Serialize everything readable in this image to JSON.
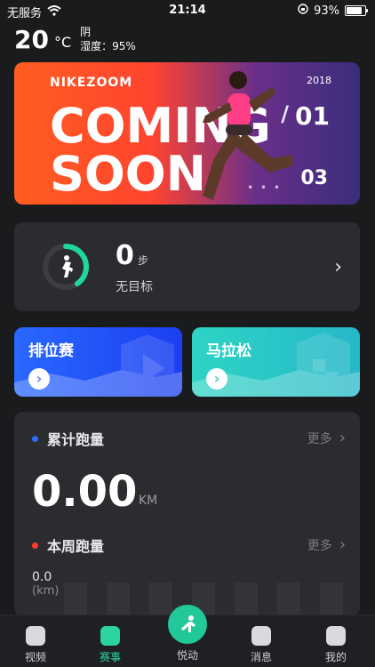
{
  "status": {
    "carrier": "无服务",
    "time": "21:14",
    "battery_percent": "93%",
    "battery_level": 0.93
  },
  "weather": {
    "temp": "20",
    "unit": "°C",
    "condition": "阴",
    "humidity": "湿度：95%"
  },
  "banner": {
    "brand": "NIKEZOOM",
    "line1": "COMING",
    "line2": "SOON",
    "year": "2018",
    "slash": "/",
    "index": "01",
    "total": "03",
    "dots": "• • •"
  },
  "steps": {
    "count": "0",
    "unit": "步",
    "goal": "无目标"
  },
  "cards": {
    "rank": "排位赛",
    "marathon": "马拉松"
  },
  "stats": {
    "cumulative_label": "累计跑量",
    "more1": "更多",
    "distance": "0.00",
    "distance_unit": "KM",
    "week_label": "本周跑量",
    "more2": "更多",
    "week_value": "0.0",
    "week_unit": "(km)"
  },
  "tabs": [
    {
      "label": "视频"
    },
    {
      "label": "赛事"
    },
    {
      "label": "悦动"
    },
    {
      "label": "消息"
    },
    {
      "label": "我的"
    }
  ],
  "colors": {
    "accent": "#2ad3a0",
    "rank_gradient_start": "#2a68ff",
    "marathon_gradient_start": "#2ed4c4",
    "dot_blue": "#2a6bff",
    "dot_red": "#ff3b30"
  }
}
